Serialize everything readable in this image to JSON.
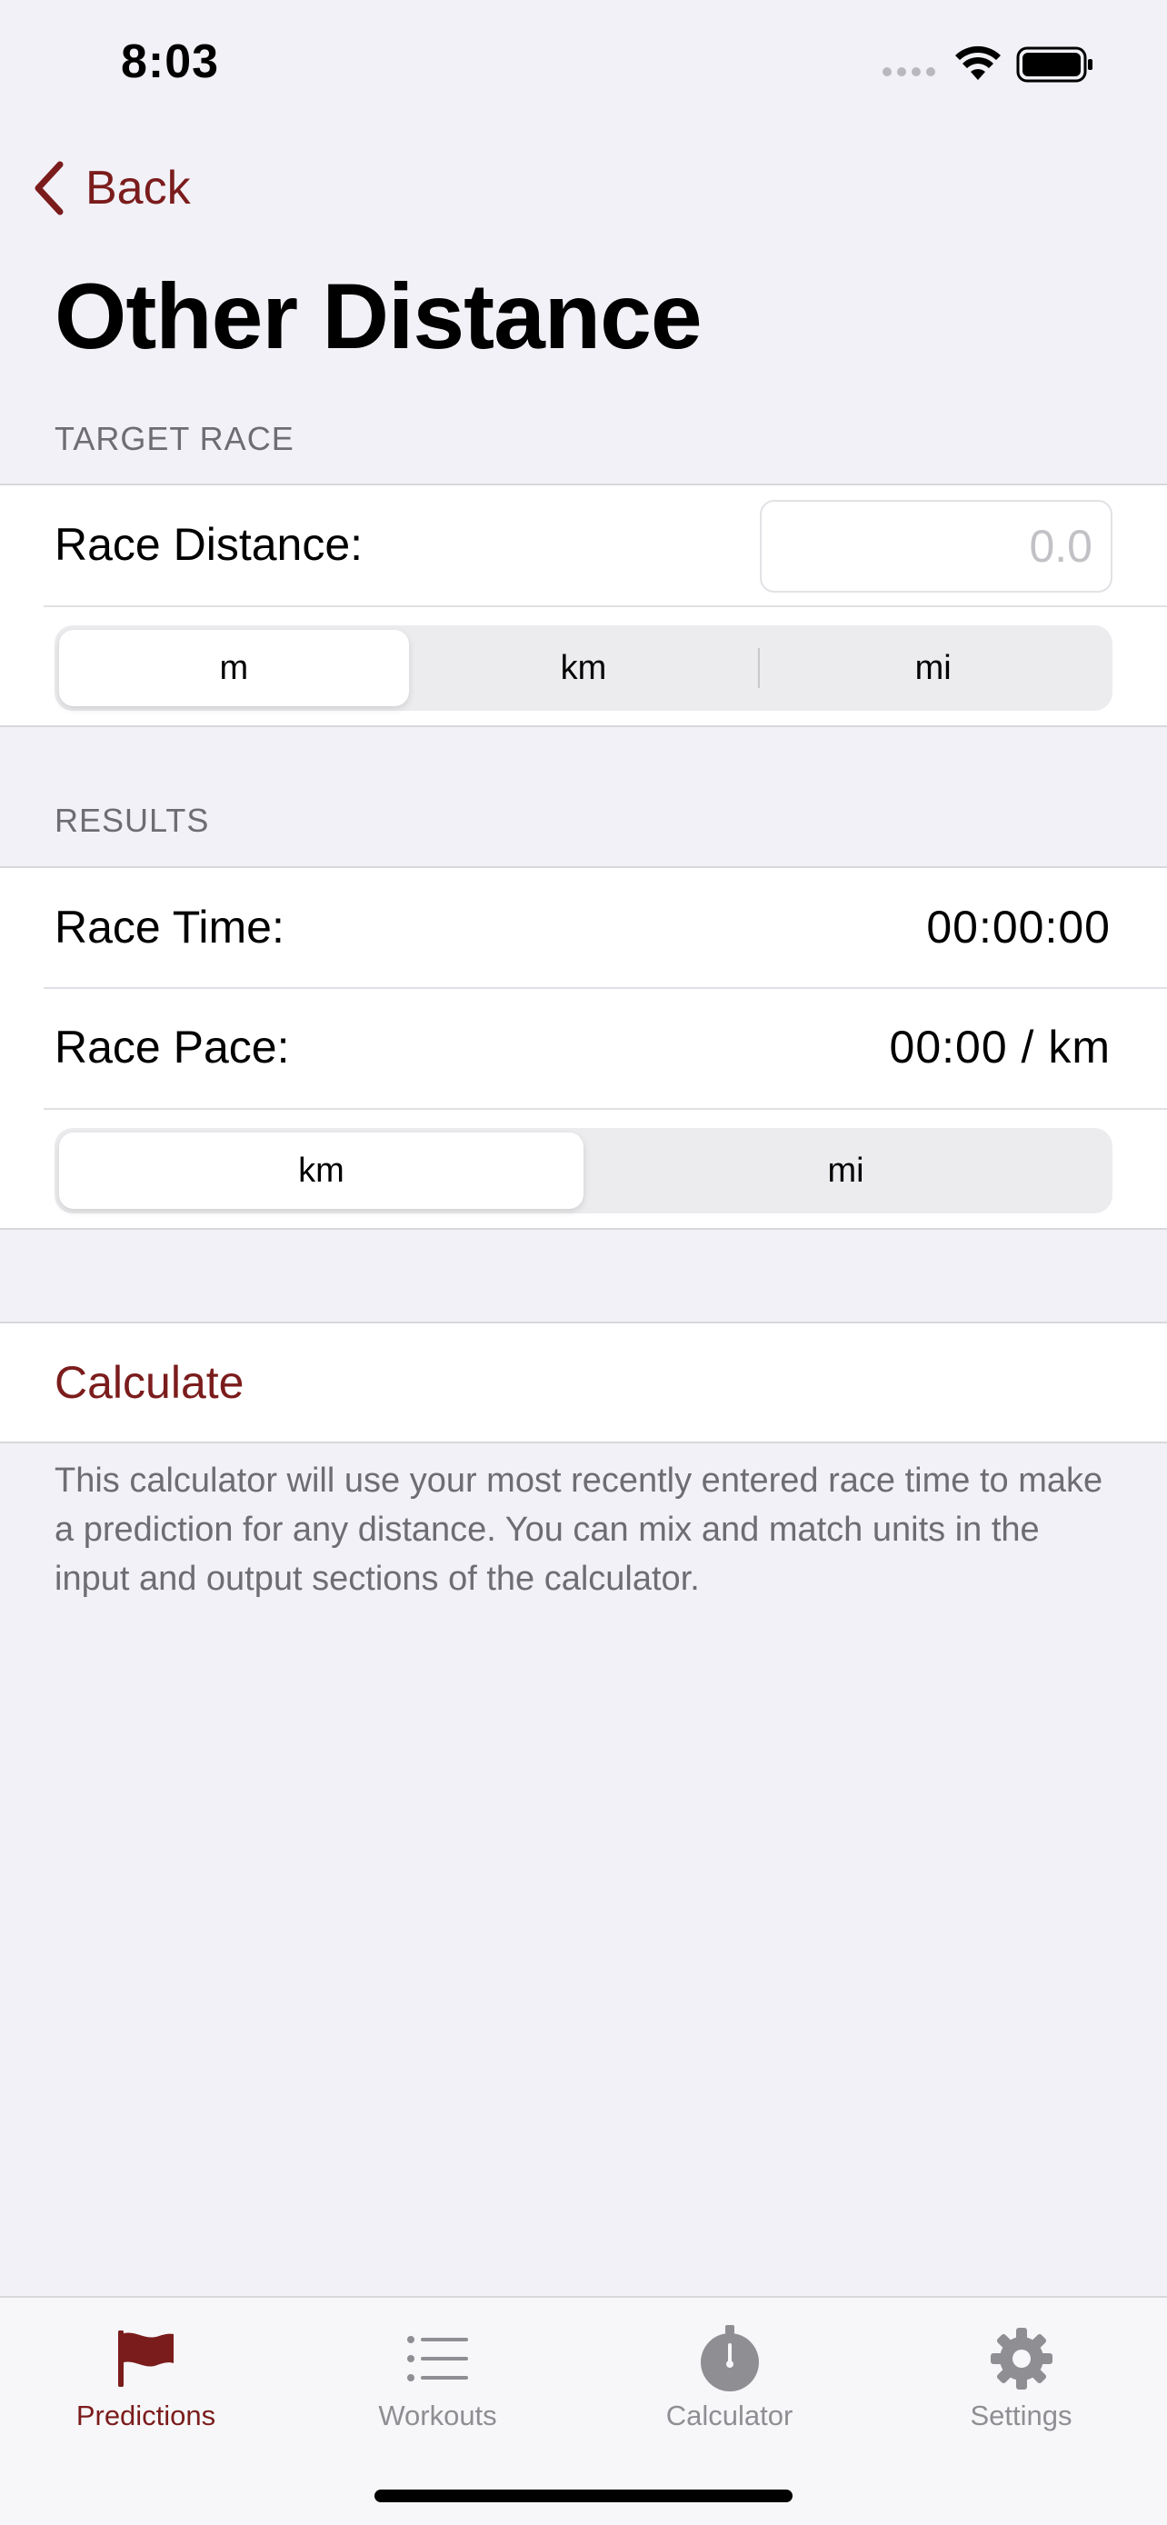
{
  "status_bar": {
    "time": "8:03"
  },
  "nav": {
    "back_label": "Back",
    "title": "Other Distance"
  },
  "target_race": {
    "header": "TARGET RACE",
    "distance_label": "Race Distance:",
    "distance_placeholder": "0.0",
    "distance_value": "",
    "units": [
      {
        "label": "m",
        "selected": true
      },
      {
        "label": "km",
        "selected": false
      },
      {
        "label": "mi",
        "selected": false
      }
    ]
  },
  "results": {
    "header": "RESULTS",
    "time_label": "Race Time:",
    "time_value": "00:00:00",
    "pace_label": "Race Pace:",
    "pace_value": "00:00 / km",
    "pace_units": [
      {
        "label": "km",
        "selected": true
      },
      {
        "label": "mi",
        "selected": false
      }
    ]
  },
  "calculate": {
    "label": "Calculate",
    "note": "This calculator will use your most recently entered race time to make a prediction for any distance. You can mix and match units in the input and output sections of the calculator."
  },
  "tab_bar": {
    "tabs": [
      {
        "label": "Predictions",
        "icon": "flag-icon",
        "active": true
      },
      {
        "label": "Workouts",
        "icon": "list-icon",
        "active": false
      },
      {
        "label": "Calculator",
        "icon": "stopwatch-icon",
        "active": false
      },
      {
        "label": "Settings",
        "icon": "gear-icon",
        "active": false
      }
    ]
  },
  "colors": {
    "accent": "#7b1c1c",
    "background": "#f2f1f7",
    "secondary_text": "#6d6d72"
  }
}
